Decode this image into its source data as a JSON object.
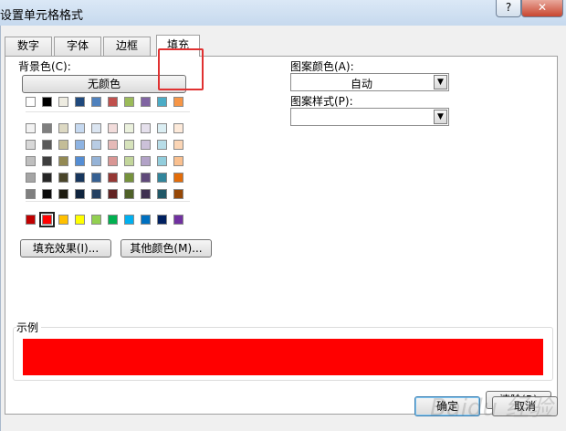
{
  "window": {
    "title": "设置单元格格式",
    "help": "?",
    "close": "✕"
  },
  "tabs": [
    "数字",
    "字体",
    "边框",
    "填充"
  ],
  "fill": {
    "bg_label": "背景色(C):",
    "no_color": "无颜色",
    "fill_effects": "填充效果(I)...",
    "more_colors": "其他颜色(M)...",
    "pattern_color_label": "图案颜色(A):",
    "pattern_color_value": "自动",
    "pattern_style_label": "图案样式(P):",
    "pattern_style_value": "",
    "sample_label": "示例",
    "sample_color": "#ff0000",
    "clear": "清除(R)"
  },
  "buttons": {
    "ok": "确定",
    "cancel": "取消"
  },
  "watermark": "Baidu 经验",
  "palette": {
    "row_top": [
      "#ffffff",
      "#000000",
      "#eeece1",
      "#1f497d",
      "#4f81bd",
      "#c0504d",
      "#9bbb59",
      "#8064a2",
      "#4bacc6",
      "#f79646"
    ],
    "theme_rows": [
      [
        "#f2f2f2",
        "#7f7f7f",
        "#ddd9c3",
        "#c6d9f0",
        "#dbe5f1",
        "#f2dcdb",
        "#ebf1dd",
        "#e5e0ec",
        "#dbeef3",
        "#fdeada"
      ],
      [
        "#d8d8d8",
        "#595959",
        "#c4bd97",
        "#8db3e2",
        "#b8cce4",
        "#e5b9b7",
        "#d7e3bc",
        "#ccc1d9",
        "#b7dde8",
        "#fbd5b5"
      ],
      [
        "#bfbfbf",
        "#3f3f3f",
        "#938953",
        "#548dd4",
        "#95b3d7",
        "#d99694",
        "#c3d69b",
        "#b2a2c7",
        "#92cddc",
        "#fac08f"
      ],
      [
        "#a5a5a5",
        "#262626",
        "#494429",
        "#17365d",
        "#366092",
        "#953734",
        "#76923c",
        "#5f497a",
        "#31859b",
        "#e36c09"
      ],
      [
        "#7f7f7f",
        "#0c0c0c",
        "#1d1b10",
        "#0f243e",
        "#244061",
        "#632423",
        "#4f6128",
        "#3f3151",
        "#205867",
        "#974806"
      ]
    ],
    "row_standard": [
      "#c00000",
      "#ff0000",
      "#ffc000",
      "#ffff00",
      "#92d050",
      "#00b050",
      "#00b0f0",
      "#0070c0",
      "#002060",
      "#7030a0"
    ],
    "selected_standard_index": 1
  }
}
